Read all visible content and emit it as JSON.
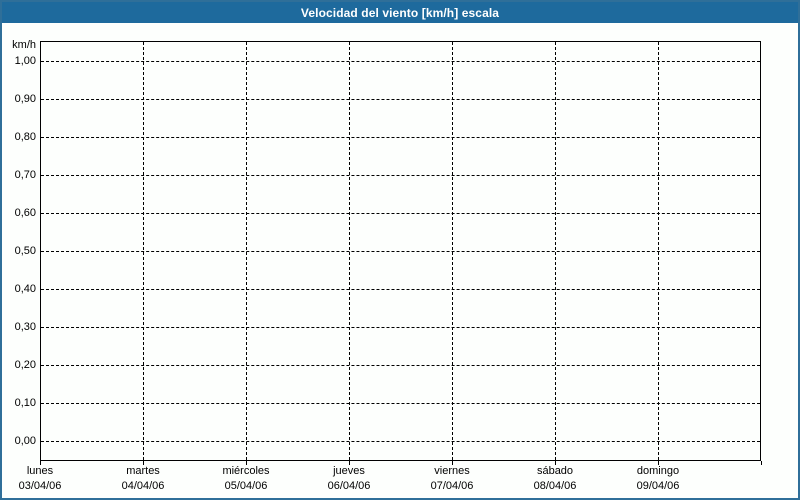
{
  "window": {
    "title": "Velocidad del viento [km/h] escala"
  },
  "colors": {
    "titlebar_bg": "#1e6a9d",
    "titlebar_text": "#ffffff",
    "frame_border": "#2f6f99",
    "chart_bg": "#fdfffd",
    "grid_line": "#000000",
    "label_text": "#000000"
  },
  "chart_data": {
    "type": "line",
    "title": "Velocidad del viento [km/h] escala",
    "y_unit": "km/h",
    "xlabel": "",
    "ylabel": "",
    "ylim": [
      0.0,
      1.0
    ],
    "y_tick_step": 0.1,
    "y_ticks": [
      "1,00",
      "0,90",
      "0,80",
      "0,70",
      "0,60",
      "0,50",
      "0,40",
      "0,30",
      "0,20",
      "0,10",
      "0,00"
    ],
    "grid": "dashed horizontal and vertical gridlines",
    "legend": "none",
    "x_categories": [
      {
        "day": "lunes",
        "date": "03/04/06"
      },
      {
        "day": "martes",
        "date": "04/04/06"
      },
      {
        "day": "miércoles",
        "date": "05/04/06"
      },
      {
        "day": "jueves",
        "date": "06/04/06"
      },
      {
        "day": "viernes",
        "date": "07/04/06"
      },
      {
        "day": "sábado",
        "date": "08/04/06"
      },
      {
        "day": "domingo",
        "date": "09/04/06"
      }
    ],
    "series": []
  }
}
